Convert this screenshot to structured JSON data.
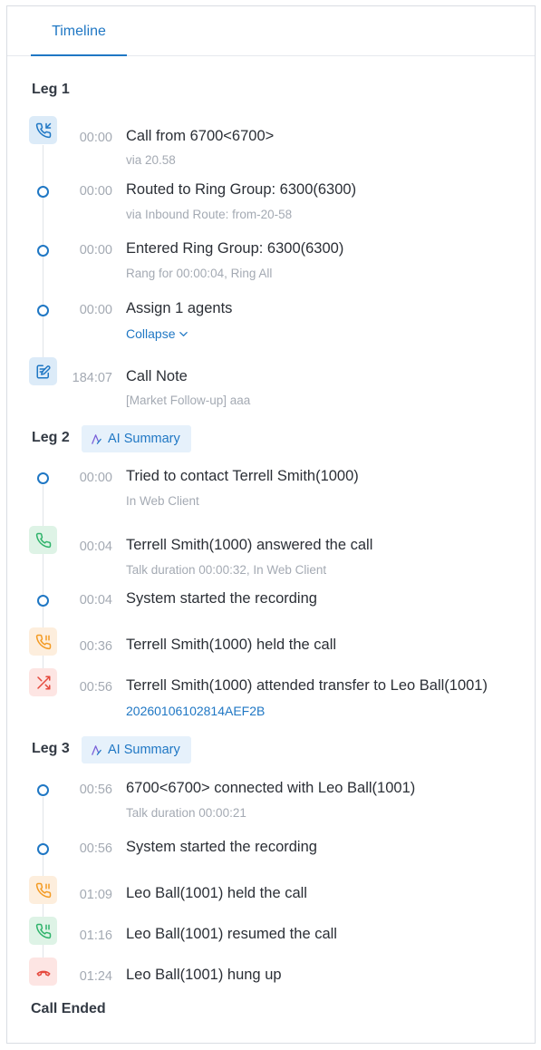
{
  "tabs": {
    "timeline": "Timeline"
  },
  "legs": [
    {
      "label": "Leg 1",
      "events": [
        {
          "time": "00:00",
          "title": "Call from 6700<6700>",
          "sub": "via 20.58"
        },
        {
          "time": "00:00",
          "title": "Routed to Ring Group: 6300(6300)",
          "sub": "via Inbound Route: from-20-58"
        },
        {
          "time": "00:00",
          "title": "Entered Ring Group: 6300(6300)",
          "sub": "Rang for 00:00:04, Ring All"
        },
        {
          "time": "00:00",
          "title": "Assign 1 agents",
          "link": "Collapse"
        },
        {
          "time": "184:07",
          "title": "Call Note",
          "sub": "[Market Follow-up] aaa"
        }
      ]
    },
    {
      "label": "Leg 2",
      "ai_summary": "AI Summary",
      "events": [
        {
          "time": "00:00",
          "title": "Tried to contact Terrell Smith(1000)",
          "sub": "In Web Client"
        },
        {
          "time": "00:04",
          "title": "Terrell Smith(1000) answered the call",
          "sub": "Talk duration 00:00:32, In Web Client"
        },
        {
          "time": "00:04",
          "title": "System started the recording"
        },
        {
          "time": "00:36",
          "title": "Terrell Smith(1000) held the call"
        },
        {
          "time": "00:56",
          "title": "Terrell Smith(1000) attended transfer to Leo Ball(1001)",
          "link": "20260106102814AEF2B"
        }
      ]
    },
    {
      "label": "Leg 3",
      "ai_summary": "AI Summary",
      "events": [
        {
          "time": "00:56",
          "title": "6700<6700> connected with Leo Ball(1001)",
          "sub": "Talk duration 00:00:21"
        },
        {
          "time": "00:56",
          "title": "System started the recording"
        },
        {
          "time": "01:09",
          "title": "Leo Ball(1001) held the call"
        },
        {
          "time": "01:16",
          "title": "Leo Ball(1001) resumed the call"
        },
        {
          "time": "01:24",
          "title": "Leo Ball(1001) hung up"
        }
      ]
    }
  ],
  "footer": {
    "call_ended": "Call Ended"
  },
  "icons": {
    "incoming_call": "phone-incoming-icon",
    "note": "note-edit-icon",
    "answered": "phone-answered-icon",
    "hold": "phone-hold-icon",
    "resume": "phone-resume-icon",
    "transfer": "transfer-shuffle-icon",
    "hangup": "phone-hangup-icon",
    "ai": "ai-sparkle-icon"
  },
  "colors": {
    "accent": "#1f77c4",
    "green": "#2fb36b",
    "orange": "#f39b24",
    "red": "#e5483c"
  }
}
